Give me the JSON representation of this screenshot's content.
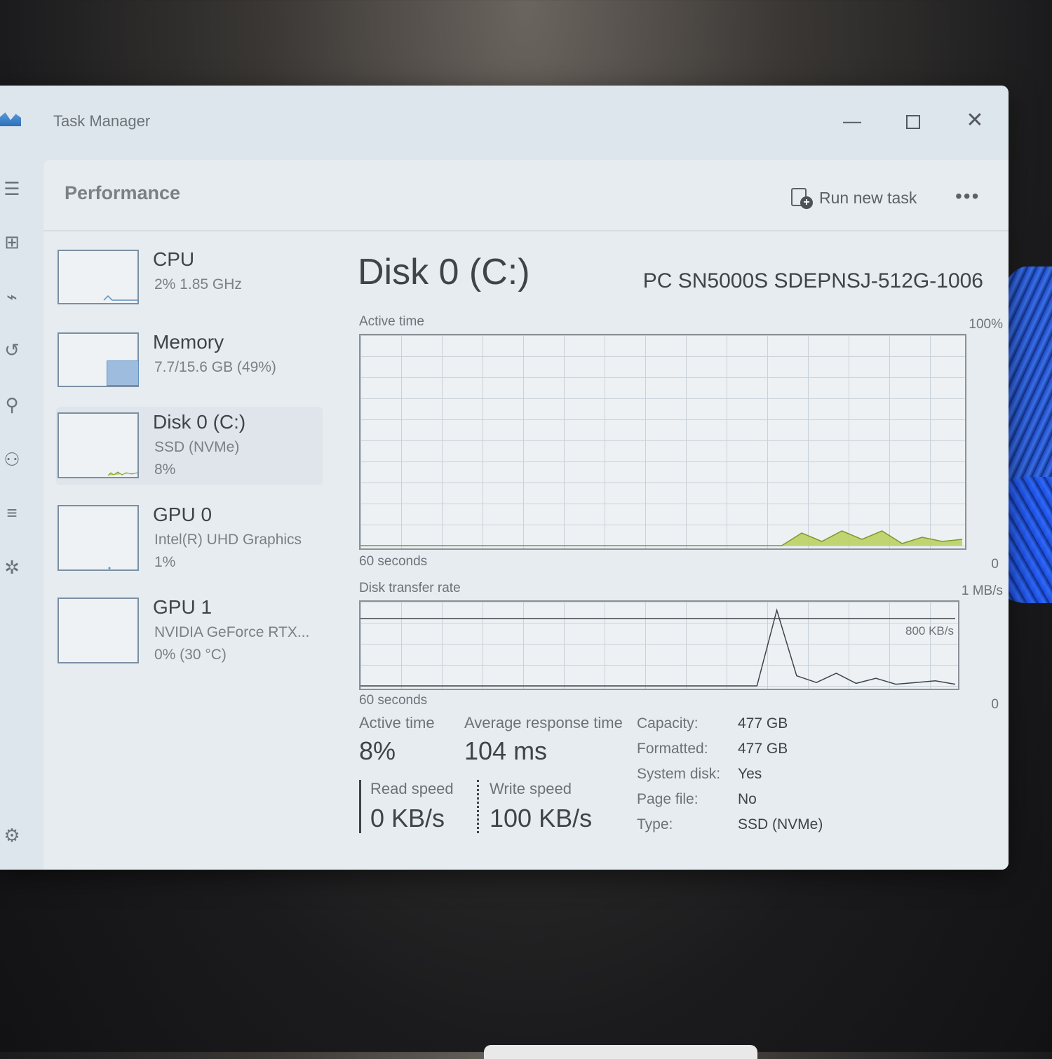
{
  "window": {
    "title": "Task Manager"
  },
  "header": {
    "title": "Performance",
    "run_new_task": "Run new task",
    "more": "•••"
  },
  "nav_icons": [
    "hamburger-icon",
    "processes-icon",
    "performance-icon",
    "app-history-icon",
    "startup-apps-icon",
    "users-icon",
    "details-icon",
    "services-icon",
    "settings-icon"
  ],
  "sidebar": {
    "items": [
      {
        "name": "CPU",
        "sub": "2%  1.85 GHz",
        "sub2": ""
      },
      {
        "name": "Memory",
        "sub": "7.7/15.6 GB (49%)",
        "sub2": ""
      },
      {
        "name": "Disk 0 (C:)",
        "sub": "SSD (NVMe)",
        "sub2": "8%"
      },
      {
        "name": "GPU 0",
        "sub": "Intel(R) UHD Graphics",
        "sub2": "1%"
      },
      {
        "name": "GPU 1",
        "sub": "NVIDIA GeForce RTX...",
        "sub2": "0%  (30 °C)"
      }
    ],
    "memory_percent": 49
  },
  "main": {
    "title": "Disk 0 (C:)",
    "model": "PC SN5000S SDEPNSJ-512G-1006",
    "active_chart": {
      "label": "Active time",
      "max": "100%",
      "x_left": "60 seconds",
      "x_right": "0"
    },
    "transfer_chart": {
      "label": "Disk transfer rate",
      "max": "1 MB/s",
      "ref": "800 KB/s",
      "x_left": "60 seconds",
      "x_right": "0"
    }
  },
  "chart_data": [
    {
      "type": "area",
      "title": "Active time",
      "x": [
        60,
        58,
        56,
        54,
        52,
        50,
        48,
        46,
        44,
        42,
        40,
        38,
        36,
        34,
        32,
        30,
        28,
        26,
        24,
        22,
        20,
        18,
        16,
        14,
        12,
        10,
        8,
        6,
        4,
        2,
        0
      ],
      "values": [
        0,
        0,
        0,
        0,
        0,
        0,
        0,
        0,
        0,
        0,
        0,
        0,
        0,
        0,
        0,
        0,
        0,
        0,
        0,
        0,
        0,
        0,
        6,
        2,
        7,
        3,
        7,
        1,
        4,
        2,
        3
      ],
      "ylim": [
        0,
        100
      ],
      "xlabel_left": "60 seconds",
      "xlabel_right": "0",
      "color": "#b9cf5a"
    },
    {
      "type": "line",
      "title": "Disk transfer rate",
      "x": [
        60,
        58,
        56,
        54,
        52,
        50,
        48,
        46,
        44,
        42,
        40,
        38,
        36,
        34,
        32,
        30,
        28,
        26,
        24,
        22,
        20,
        18,
        16,
        14,
        12,
        10,
        8,
        6,
        4,
        2,
        0
      ],
      "series": [
        {
          "values": [
            0,
            0,
            0,
            0,
            0,
            0,
            0,
            0,
            0,
            0,
            0,
            0,
            0,
            0,
            0,
            0,
            0,
            0,
            0,
            0,
            0,
            900,
            120,
            40,
            150,
            30,
            90,
            20,
            40,
            60,
            20
          ],
          "color": "#3e4449"
        }
      ],
      "ylim": [
        0,
        1000
      ],
      "ref_line": 800
    }
  ],
  "stats": {
    "active_time_label": "Active time",
    "active_time": "8%",
    "avg_response_label": "Average response time",
    "avg_response": "104 ms",
    "read_label": "Read speed",
    "read": "0 KB/s",
    "write_label": "Write speed",
    "write": "100 KB/s",
    "props": [
      {
        "k": "Capacity:",
        "v": "477 GB"
      },
      {
        "k": "Formatted:",
        "v": "477 GB"
      },
      {
        "k": "System disk:",
        "v": "Yes"
      },
      {
        "k": "Page file:",
        "v": "No"
      },
      {
        "k": "Type:",
        "v": "SSD (NVMe)"
      }
    ]
  }
}
